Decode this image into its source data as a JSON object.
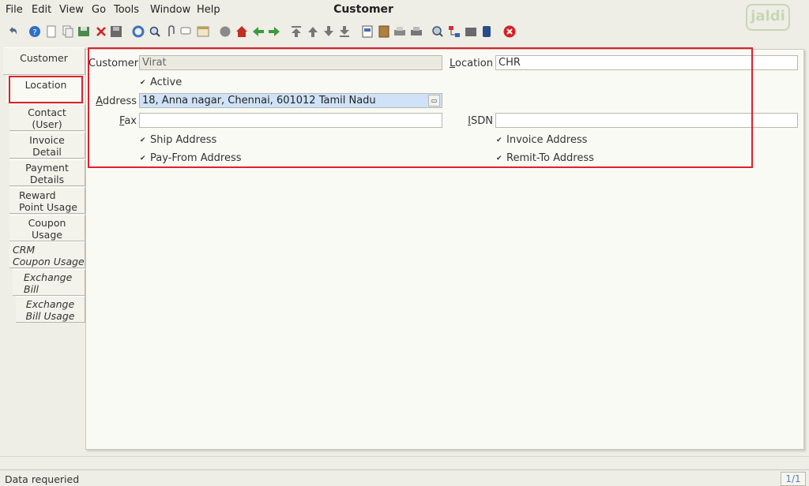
{
  "menu": {
    "items": [
      {
        "label": "File"
      },
      {
        "label": "Edit"
      },
      {
        "label": "View"
      },
      {
        "label": "Go"
      },
      {
        "label": "Tools"
      },
      {
        "label": "Window"
      },
      {
        "label": "Help"
      }
    ]
  },
  "window": {
    "title": "Customer",
    "logo": "jaldi"
  },
  "toolbar": {
    "icons": [
      "undo-icon",
      "help-icon",
      "new-icon",
      "copy-icon",
      "save-icon",
      "delete-icon",
      "save-disk-icon",
      "refresh-icon",
      "find-icon",
      "attach-icon",
      "chat-icon",
      "history-icon",
      "stop-icon",
      "home-icon",
      "back-icon",
      "forward-icon",
      "first-icon",
      "previous-icon",
      "next-icon",
      "last-icon",
      "report-icon",
      "archive-icon",
      "print-preview-icon",
      "print-icon",
      "zoom-icon",
      "workflow-icon",
      "request-icon",
      "product-icon",
      "close-icon"
    ]
  },
  "tabs": [
    {
      "label": "Customer"
    },
    {
      "label": "Location"
    },
    {
      "label": "Contact\n(User)"
    },
    {
      "label": "Invoice\nDetail"
    },
    {
      "label": "Payment\nDetails"
    },
    {
      "label": "Reward\nPoint Usage"
    },
    {
      "label": "Coupon\nUsage"
    },
    {
      "label": "CRM\nCoupon Usage"
    },
    {
      "label": "Exchange\nBill"
    },
    {
      "label": "Exchange\nBill Usage"
    }
  ],
  "form": {
    "customer": {
      "label": "Customer",
      "value": "Virat"
    },
    "location": {
      "label": "Location",
      "value": "CHR"
    },
    "active": {
      "label": "Active",
      "checked": true
    },
    "address": {
      "label": "Address",
      "value": "18, Anna nagar, Chennai,  601012 Tamil Nadu"
    },
    "fax": {
      "label": "Fax",
      "value": ""
    },
    "isdn": {
      "label": "ISDN",
      "value": ""
    },
    "ship_address": {
      "label": "Ship Address",
      "checked": true
    },
    "invoice_address": {
      "label": "Invoice Address",
      "checked": true
    },
    "pay_from_address": {
      "label": "Pay-From Address",
      "checked": true
    },
    "remit_to_address": {
      "label": "Remit-To Address",
      "checked": true
    }
  },
  "status": {
    "message": "Data requeried",
    "page": "1/1"
  },
  "colors": {
    "highlight": "#e0202a",
    "address_bg": "#cfe2f7"
  }
}
